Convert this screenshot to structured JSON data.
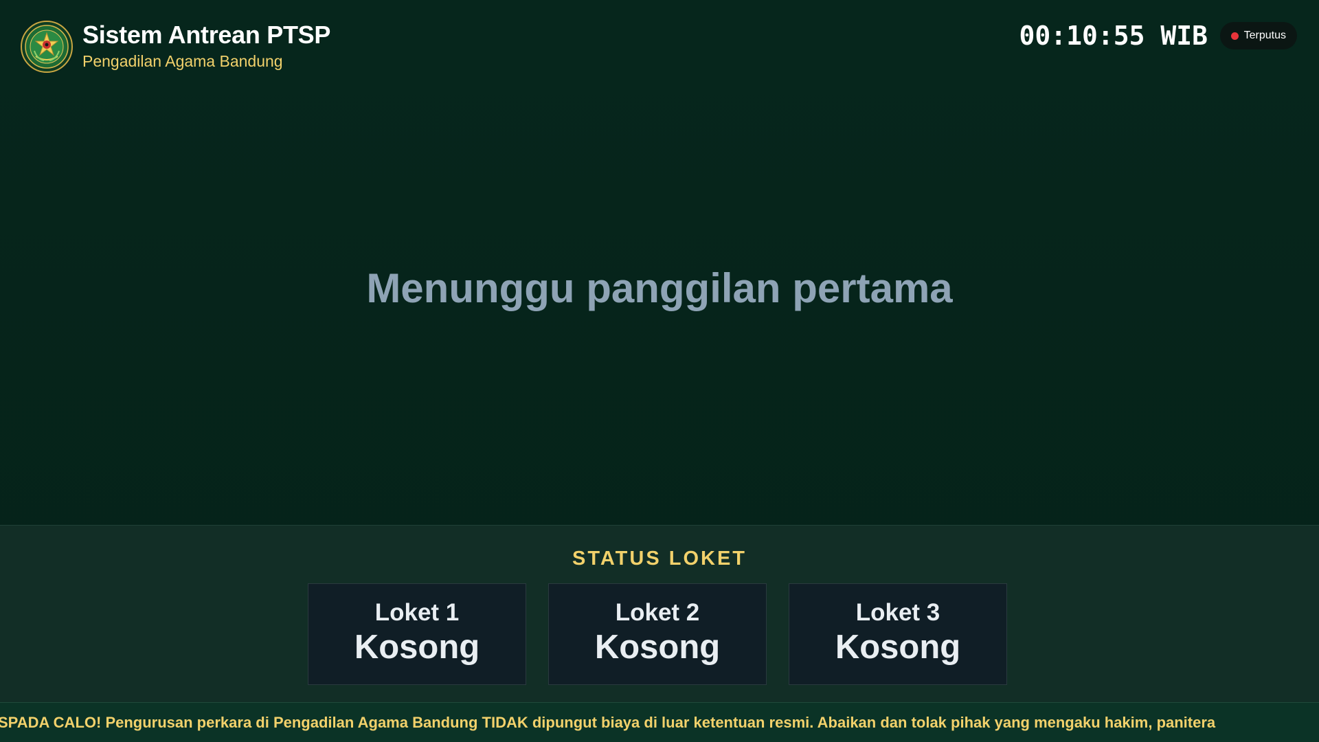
{
  "header": {
    "title": "Sistem Antrean PTSP",
    "subtitle": "Pengadilan Agama Bandung",
    "clock": "00:10:55 WIB",
    "connection_status": "Terputus",
    "connection_status_color": "#e8343a",
    "logo_icon": "court-emblem-icon"
  },
  "main": {
    "waiting_message": "Menunggu panggilan pertama"
  },
  "loket_section": {
    "heading": "STATUS LOKET",
    "counters": [
      {
        "name": "Loket 1",
        "status": "Kosong"
      },
      {
        "name": "Loket 2",
        "status": "Kosong"
      },
      {
        "name": "Loket 3",
        "status": "Kosong"
      }
    ]
  },
  "ticker": {
    "text": "SPADA CALO! Pengurusan perkara di Pengadilan Agama Bandung TIDAK dipungut biaya di luar ketentuan resmi. Abaikan dan tolak pihak yang mengaku hakim, panitera"
  },
  "colors": {
    "background": "#06251c",
    "accent_gold": "#f2d16b",
    "muted_text": "#8ea3b5"
  }
}
